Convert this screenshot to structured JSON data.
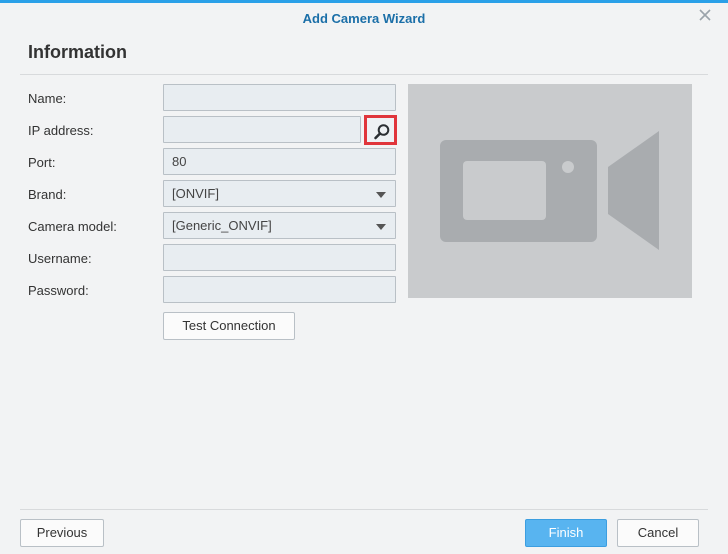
{
  "dialog": {
    "title": "Add Camera Wizard",
    "section_title": "Information"
  },
  "form": {
    "name": {
      "label": "Name:",
      "value": ""
    },
    "ip_address": {
      "label": "IP address:",
      "value": ""
    },
    "port": {
      "label": "Port:",
      "value": "80"
    },
    "brand": {
      "label": "Brand:",
      "value": "[ONVIF]"
    },
    "camera_model": {
      "label": "Camera model:",
      "value": "[Generic_ONVIF]"
    },
    "username": {
      "label": "Username:",
      "value": ""
    },
    "password": {
      "label": "Password:",
      "value": ""
    },
    "test_connection_label": "Test Connection"
  },
  "footer": {
    "previous_label": "Previous",
    "finish_label": "Finish",
    "cancel_label": "Cancel"
  },
  "icons": {
    "close": "close-icon",
    "search": "search-icon",
    "preview": "video-camera-icon",
    "dropdown": "chevron-down-icon"
  },
  "colors": {
    "accent": "#2aa0e8",
    "title": "#1b6fa8",
    "primary_button": "#58b4f0",
    "highlight": "#e0353b"
  }
}
